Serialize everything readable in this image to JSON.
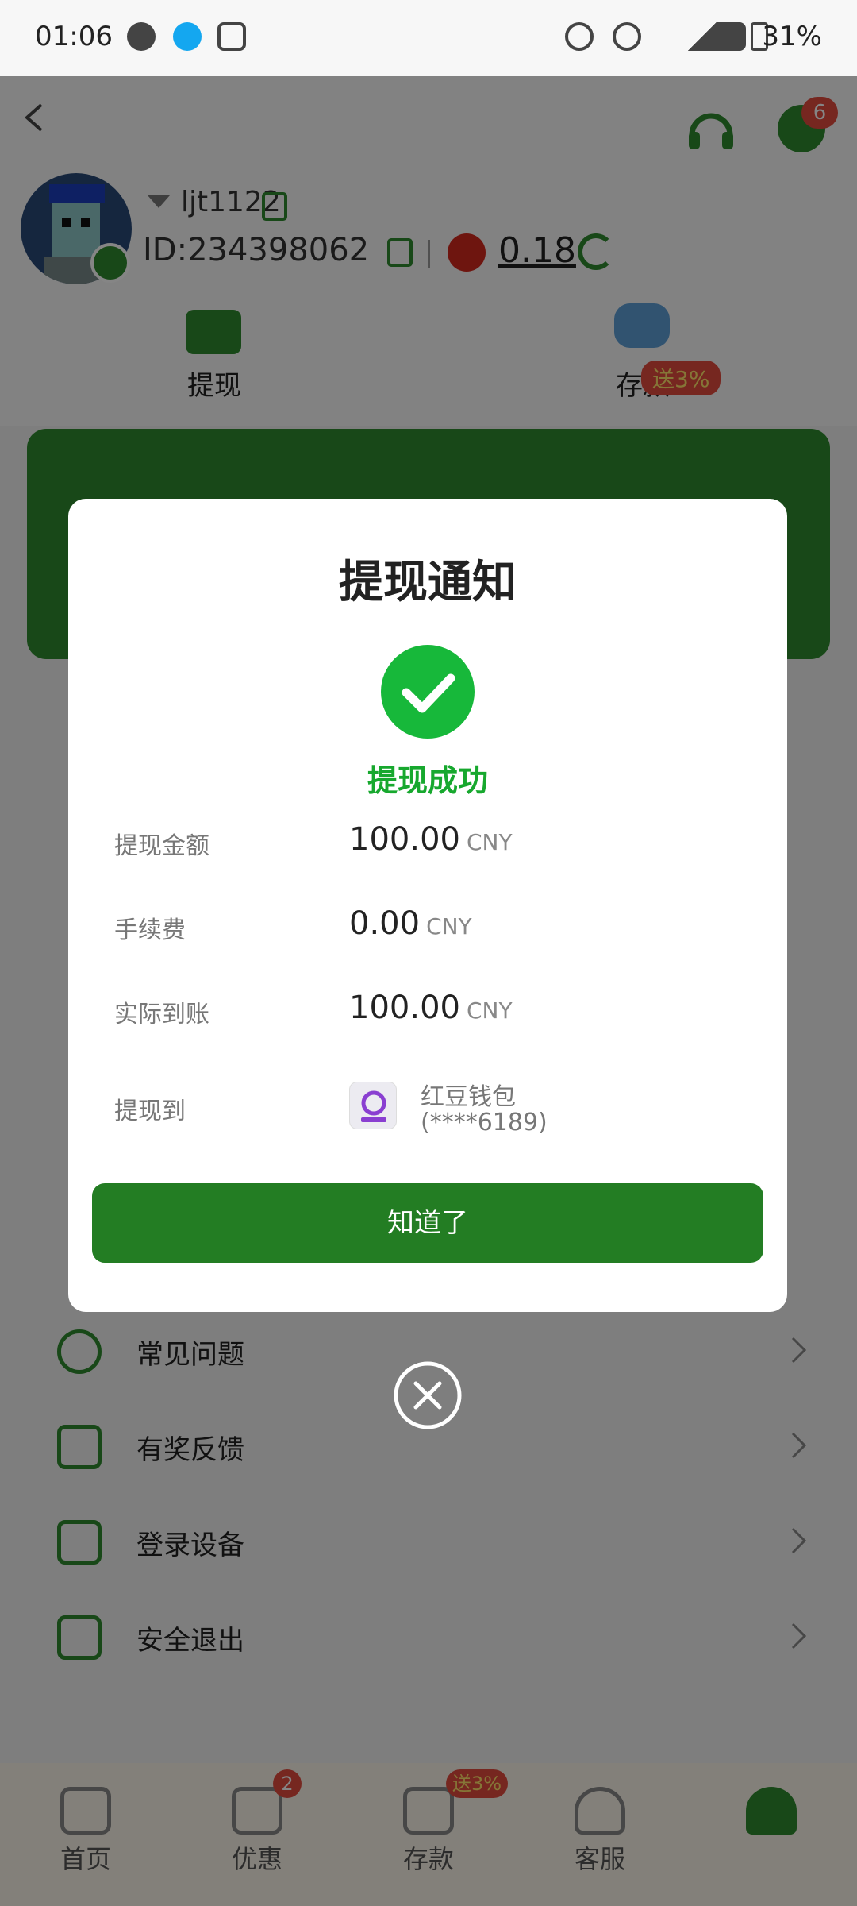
{
  "status_bar": {
    "time": "01:06",
    "battery": "31%"
  },
  "header": {
    "username": "ljt1122",
    "user_id": "ID:234398062",
    "balance": "0.18",
    "message_count": "6",
    "quick_actions": [
      {
        "label": "提现",
        "icon": "withdraw-icon"
      },
      {
        "label": "存款",
        "icon": "wallet-bag-icon",
        "badge": "送3%"
      }
    ]
  },
  "menu": {
    "items": [
      {
        "label": "常见问题",
        "icon": "question-icon"
      },
      {
        "label": "有奖反馈",
        "icon": "edit-icon"
      },
      {
        "label": "登录设备",
        "icon": "devices-icon"
      },
      {
        "label": "安全退出",
        "icon": "logout-icon"
      }
    ]
  },
  "dialog": {
    "title": "提现通知",
    "status": "提现成功",
    "rows": [
      {
        "label": "提现金额",
        "value": "100.00",
        "unit": "CNY"
      },
      {
        "label": "手续费",
        "value": "0.00",
        "unit": "CNY"
      },
      {
        "label": "实际到账",
        "value": "100.00",
        "unit": "CNY"
      }
    ],
    "destination_label": "提现到",
    "wallet_name": "红豆钱包",
    "wallet_account": "(****6189)",
    "confirm_label": "知道了"
  },
  "bottom_nav": {
    "items": [
      {
        "label": "首页",
        "icon": "home-icon"
      },
      {
        "label": "优惠",
        "icon": "gift-icon",
        "badge": "2"
      },
      {
        "label": "存款",
        "icon": "deposit-icon",
        "badge": "送3%"
      },
      {
        "label": "客服",
        "icon": "headset-icon"
      },
      {
        "label": "",
        "icon": "profile-icon"
      }
    ]
  },
  "colors": {
    "brand_green": "#2e8b2e",
    "success_green": "#17b83a",
    "badge_red": "#e24b3f"
  }
}
